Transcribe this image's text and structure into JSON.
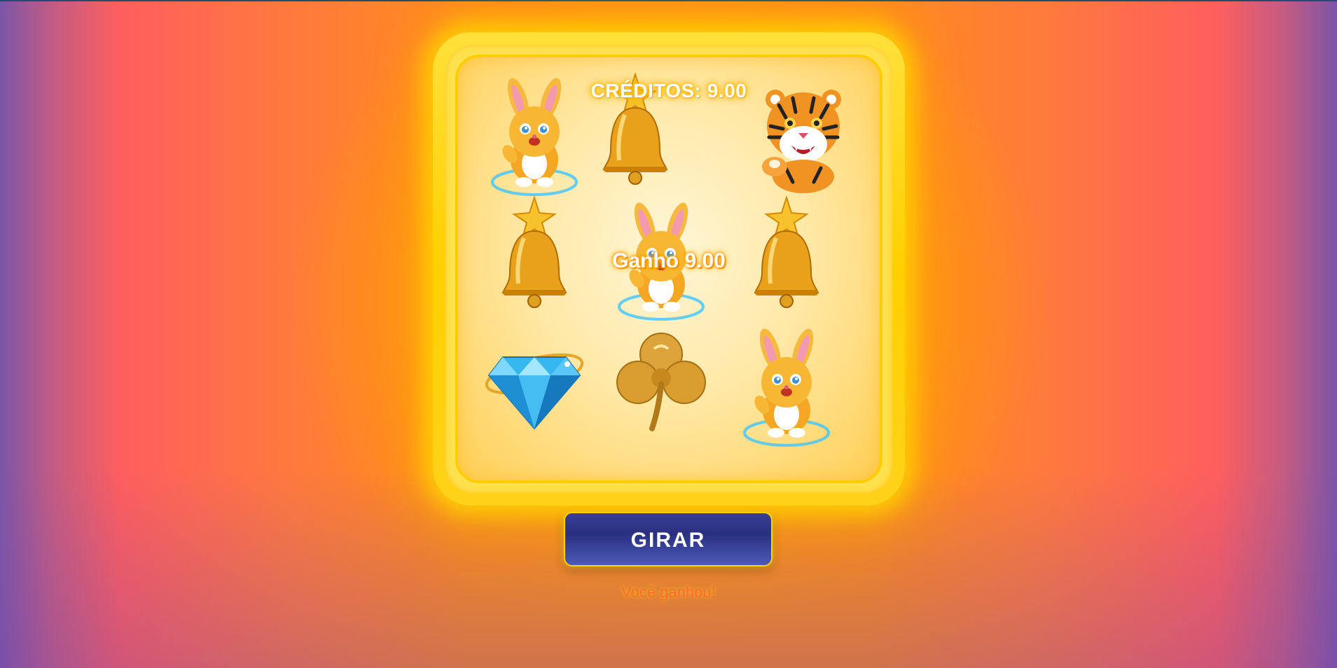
{
  "game": {
    "credits_text": "CRÉDITOS: 9.00",
    "credits_value": 9.0,
    "win_text": "Ganho 9.00",
    "win_value": 9.0,
    "spin_label": "GIRAR",
    "status_text": "Você ganhou!"
  },
  "reels": [
    [
      "rabbit-icon",
      "bell-icon",
      "tiger-icon"
    ],
    [
      "bell-icon",
      "rabbit-icon",
      "bell-icon"
    ],
    [
      "diamond-icon",
      "clover-icon",
      "rabbit-icon"
    ]
  ],
  "colors": {
    "frame": "#ffd000",
    "button": "#2a2f80",
    "status": "#ff6a3a"
  }
}
